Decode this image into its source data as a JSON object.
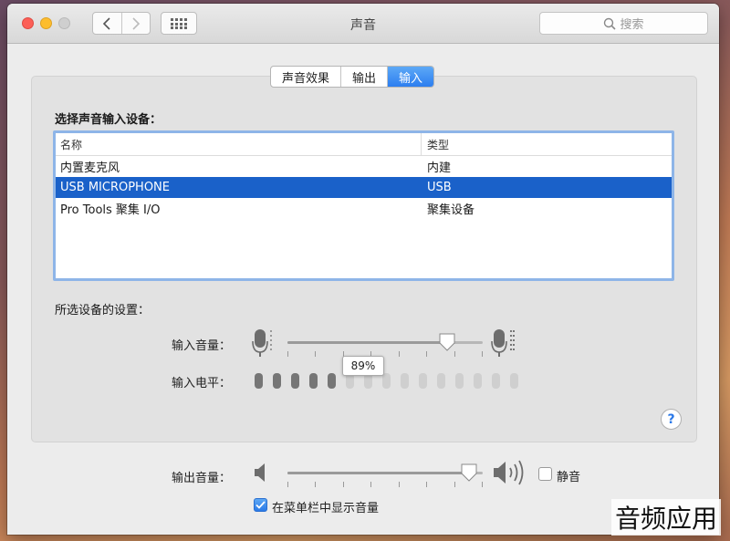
{
  "window": {
    "title": "声音"
  },
  "search": {
    "placeholder": "搜索"
  },
  "tabs": [
    {
      "label": "声音效果",
      "active": false
    },
    {
      "label": "输出",
      "active": false
    },
    {
      "label": "输入",
      "active": true
    }
  ],
  "input": {
    "section_label": "选择声音输入设备：",
    "table": {
      "headers": {
        "name": "名称",
        "type": "类型"
      },
      "rows": [
        {
          "name": "内置麦克风",
          "type": "内建",
          "selected": false
        },
        {
          "name": "USB MICROPHONE",
          "type": "USB",
          "selected": true
        },
        {
          "name": "Pro Tools 聚集 I/O",
          "type": "聚集设备",
          "selected": false
        }
      ]
    },
    "settings_label": "所选设备的设置：",
    "input_volume_label": "输入音量：",
    "input_volume_value": 0.82,
    "input_volume_tooltip": "89%",
    "input_level_label": "输入电平：",
    "input_level": {
      "lit": 5,
      "total": 15
    }
  },
  "output": {
    "volume_label": "输出音量：",
    "volume_value": 0.93,
    "mute_label": "静音",
    "mute_checked": false,
    "show_in_menubar_label": "在菜单栏中显示音量",
    "show_in_menubar_checked": true
  },
  "watermark": "音频应用",
  "colors": {
    "accent": "#2c7ef0",
    "selection": "#1a61c9"
  }
}
